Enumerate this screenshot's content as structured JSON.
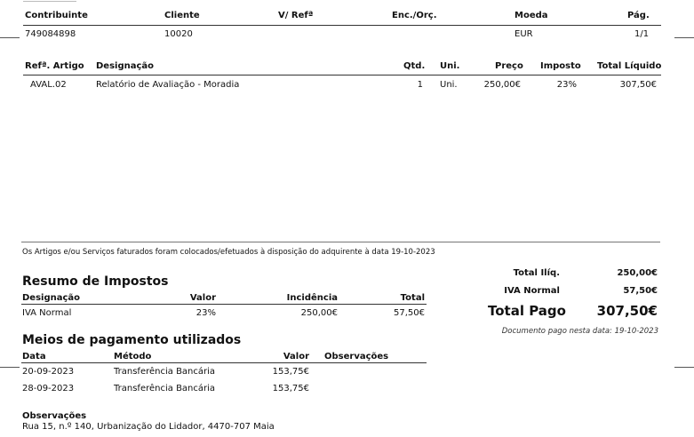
{
  "header": {
    "labels": {
      "contribuinte": "Contribuinte",
      "cliente": "Cliente",
      "v_ref": "V/ Refª",
      "enc_orc": "Enc./Orç.",
      "moeda": "Moeda",
      "pag": "Pág."
    },
    "values": {
      "contribuinte": "749084898",
      "cliente": "10020",
      "moeda": "EUR",
      "pag": "1/1"
    }
  },
  "items": {
    "columns": {
      "ref": "Refª. Artigo",
      "designacao": "Designação",
      "qtd": "Qtd.",
      "uni": "Uni.",
      "preco": "Preço",
      "imposto": "Imposto",
      "total": "Total Líquido"
    },
    "rows": [
      {
        "ref": "AVAL.02",
        "designacao": "Relatório de Avaliação - Moradia",
        "qtd": "1",
        "uni": "Uni.",
        "preco": "250,00€",
        "imposto": "23%",
        "total": "307,50€"
      }
    ]
  },
  "disposal_note": "Os Artigos e/ou Serviços faturados foram colocados/efetuados à disposição do adquirente à data 19-10-2023",
  "tax_summary": {
    "title": "Resumo de Impostos",
    "columns": {
      "designacao": "Designação",
      "valor": "Valor",
      "incidencia": "Incidência",
      "total": "Total"
    },
    "rows": [
      {
        "designacao": "IVA Normal",
        "valor": "23%",
        "incidencia": "250,00€",
        "total": "57,50€"
      }
    ]
  },
  "totals": {
    "iliq_label": "Total Ilíq.",
    "iliq_value": "250,00€",
    "iva_label": "IVA Normal",
    "iva_value": "57,50€",
    "pago_label": "Total Pago",
    "pago_value": "307,50€",
    "paid_note": "Documento pago nesta data: 19-10-2023"
  },
  "payments": {
    "title": "Meios de pagamento utilizados",
    "columns": {
      "data": "Data",
      "metodo": "Método",
      "valor": "Valor",
      "obs": "Observações"
    },
    "rows": [
      {
        "data": "20-09-2023",
        "metodo": "Transferência Bancária",
        "valor": "153,75€"
      },
      {
        "data": "28-09-2023",
        "metodo": "Transferência Bancária",
        "valor": "153,75€"
      }
    ]
  },
  "observations": {
    "label": "Observações",
    "text": "Rua 15, n.º 140, Urbanização do Lidador, 4470-707 Maia"
  }
}
